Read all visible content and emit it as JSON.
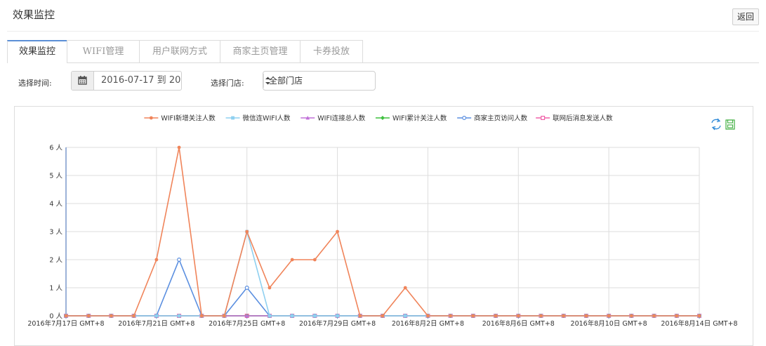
{
  "page": {
    "title": "效果监控",
    "back_label": "返回"
  },
  "tabs": [
    {
      "label": "效果监控",
      "active": true
    },
    {
      "label": "WIFI管理",
      "active": false
    },
    {
      "label": "用户联网方式",
      "active": false
    },
    {
      "label": "商家主页管理",
      "active": false
    },
    {
      "label": "卡券投放",
      "active": false
    }
  ],
  "filters": {
    "time_label": "选择时间:",
    "date_value": "2016-07-17 到 20",
    "store_label": "选择门店:",
    "store_value": "全部门店"
  },
  "chart_data": {
    "type": "line",
    "title": "",
    "xlabel": "",
    "ylabel": "",
    "ylim": [
      0,
      6
    ],
    "y_ticks": [
      "0 人",
      "1 人",
      "2 人",
      "3 人",
      "4 人",
      "5 人",
      "6 人"
    ],
    "x": [
      "2016年7月17日",
      "2016年7月18日",
      "2016年7月19日",
      "2016年7月20日",
      "2016年7月21日",
      "2016年7月22日",
      "2016年7月23日",
      "2016年7月24日",
      "2016年7月25日",
      "2016年7月26日",
      "2016年7月27日",
      "2016年7月28日",
      "2016年7月29日",
      "2016年7月30日",
      "2016年7月31日",
      "2016年8月1日",
      "2016年8月2日",
      "2016年8月3日",
      "2016年8月4日",
      "2016年8月5日",
      "2016年8月6日",
      "2016年8月7日",
      "2016年8月8日",
      "2016年8月9日",
      "2016年8月10日",
      "2016年8月11日",
      "2016年8月12日",
      "2016年8月13日",
      "2016年8月14日"
    ],
    "x_tick_labels": [
      "2016年7月17日 GMT+8",
      "2016年7月21日 GMT+8",
      "2016年7月25日 GMT+8",
      "2016年7月29日 GMT+8",
      "2016年8月2日 GMT+8",
      "2016年8月6日 GMT+8",
      "2016年8月10日 GMT+8",
      "2016年8月14日 GMT+8"
    ],
    "grid": true,
    "legend_position": "top-center",
    "series": [
      {
        "name": "WIFI新增关注人数",
        "color": "#f0845a",
        "marker": "circle-filled",
        "values": [
          0,
          0,
          0,
          0,
          2,
          6,
          0,
          0,
          3,
          1,
          2,
          2,
          3,
          0,
          0,
          1,
          0,
          0,
          0,
          0,
          0,
          0,
          0,
          0,
          0,
          0,
          0,
          0,
          0
        ]
      },
      {
        "name": "微信连WIFI人数",
        "color": "#8fd0f0",
        "marker": "square-filled",
        "values": [
          0,
          0,
          0,
          0,
          0,
          0,
          0,
          0,
          3,
          0,
          0,
          0,
          0,
          0,
          0,
          0,
          0,
          0,
          0,
          0,
          0,
          0,
          0,
          0,
          0,
          0,
          0,
          0,
          0
        ]
      },
      {
        "name": "WIFI连接总人数",
        "color": "#c070d8",
        "marker": "triangle-filled",
        "values": [
          0,
          0,
          0,
          0,
          0,
          0,
          0,
          0,
          0,
          0,
          0,
          0,
          0,
          0,
          0,
          0,
          0,
          0,
          0,
          0,
          0,
          0,
          0,
          0,
          0,
          0,
          0,
          0,
          0
        ]
      },
      {
        "name": "WIFI累计关注人数",
        "color": "#3fc03f",
        "marker": "diamond-filled",
        "values": [
          0,
          0,
          0,
          0,
          0,
          0,
          0,
          0,
          0,
          0,
          0,
          0,
          0,
          0,
          0,
          0,
          0,
          0,
          0,
          0,
          0,
          0,
          0,
          0,
          0,
          0,
          0,
          0,
          0
        ]
      },
      {
        "name": "商家主页访问人数",
        "color": "#5b8fe0",
        "marker": "circle-hollow",
        "values": [
          0,
          0,
          0,
          0,
          0,
          2,
          0,
          0,
          1,
          0,
          0,
          0,
          0,
          0,
          0,
          0,
          0,
          0,
          0,
          0,
          0,
          0,
          0,
          0,
          0,
          0,
          0,
          0,
          0
        ]
      },
      {
        "name": "联网后消息发送人数",
        "color": "#f060a8",
        "marker": "square-hollow",
        "values": [
          0,
          0,
          0,
          0,
          0,
          0,
          0,
          0,
          0,
          0,
          0,
          0,
          0,
          0,
          0,
          0,
          0,
          0,
          0,
          0,
          0,
          0,
          0,
          0,
          0,
          0,
          0,
          0,
          0
        ]
      }
    ],
    "toolbox": [
      {
        "name": "refresh-icon",
        "color": "#2f8ad8"
      },
      {
        "name": "save-icon",
        "color": "#3fae3f"
      }
    ]
  }
}
